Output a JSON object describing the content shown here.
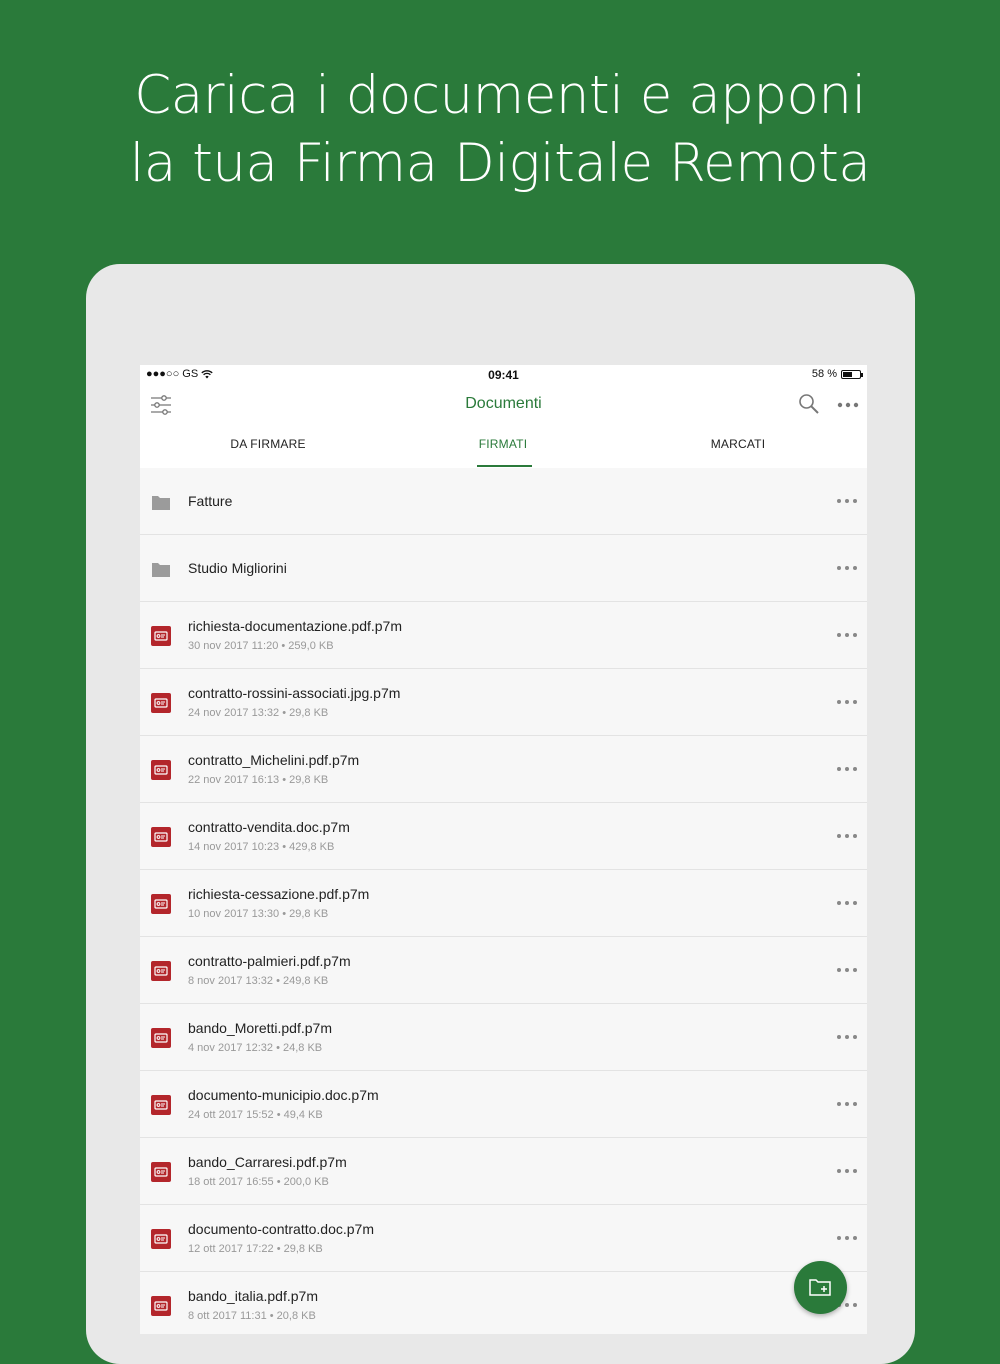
{
  "headline": {
    "line1": "Carica i documenti e apponi",
    "line2": "la tua Firma Digitale Remota"
  },
  "statusbar": {
    "carrier": "●●●○○ GS",
    "time": "09:41",
    "battery": "58 %"
  },
  "navbar": {
    "title": "Documenti",
    "icons": [
      "filter-icon",
      "search-icon",
      "more-icon"
    ]
  },
  "tabs": [
    {
      "label": "DA FIRMARE"
    },
    {
      "label": "FIRMATI",
      "active": true
    },
    {
      "label": "MARCATI"
    }
  ],
  "folders": [
    {
      "name": "Fatture"
    },
    {
      "name": "Studio Migliorini"
    }
  ],
  "files": [
    {
      "name": "richiesta-documentazione.pdf.p7m",
      "meta": "30 nov 2017 11:20 • 259,0 KB"
    },
    {
      "name": "contratto-rossini-associati.jpg.p7m",
      "meta": "24 nov 2017 13:32 • 29,8 KB"
    },
    {
      "name": "contratto_Michelini.pdf.p7m",
      "meta": "22 nov 2017 16:13 • 29,8 KB"
    },
    {
      "name": "contratto-vendita.doc.p7m",
      "meta": "14 nov 2017 10:23 • 429,8 KB"
    },
    {
      "name": "richiesta-cessazione.pdf.p7m",
      "meta": "10 nov 2017 13:30 • 29,8 KB"
    },
    {
      "name": "contratto-palmieri.pdf.p7m",
      "meta": "8 nov 2017 13:32 • 249,8 KB"
    },
    {
      "name": "bando_Moretti.pdf.p7m",
      "meta": "4 nov 2017 12:32 • 24,8 KB"
    },
    {
      "name": "documento-municipio.doc.p7m",
      "meta": "24 ott 2017 15:52 • 49,4 KB"
    },
    {
      "name": "bando_Carraresi.pdf.p7m",
      "meta": "18 ott 2017 16:55 • 200,0 KB"
    },
    {
      "name": "documento-contratto.doc.p7m",
      "meta": "12 ott 2017 17:22 • 29,8 KB"
    },
    {
      "name": "bando_italia.pdf.p7m",
      "meta": "8 ott 2017 11:31 • 20,8 KB"
    }
  ],
  "colors": {
    "brand_green": "#2a7a3a",
    "file_icon_red": "#b3262b",
    "folder_grey": "#9b9b9b"
  }
}
